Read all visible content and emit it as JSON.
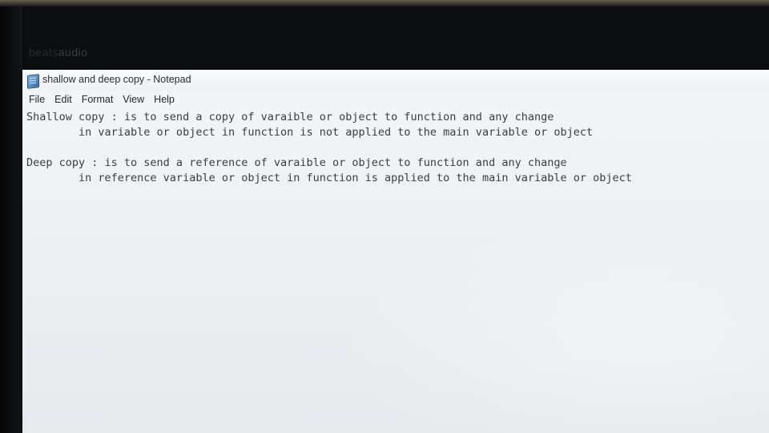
{
  "brand": {
    "text_dim": "beats",
    "text_bright": "audio"
  },
  "window": {
    "title": "shallow and deep copy - Notepad"
  },
  "menu": {
    "items": [
      "File",
      "Edit",
      "Format",
      "View",
      "Help"
    ]
  },
  "document": {
    "lines": [
      "Shallow copy : is to send a copy of varaible or object to function and any change",
      "        in variable or object in function is not applied to the main variable or object",
      "",
      "Deep copy : is to send a reference of varaible or object to function and any change",
      "        in reference variable or object in function is applied to the main variable or object"
    ]
  }
}
